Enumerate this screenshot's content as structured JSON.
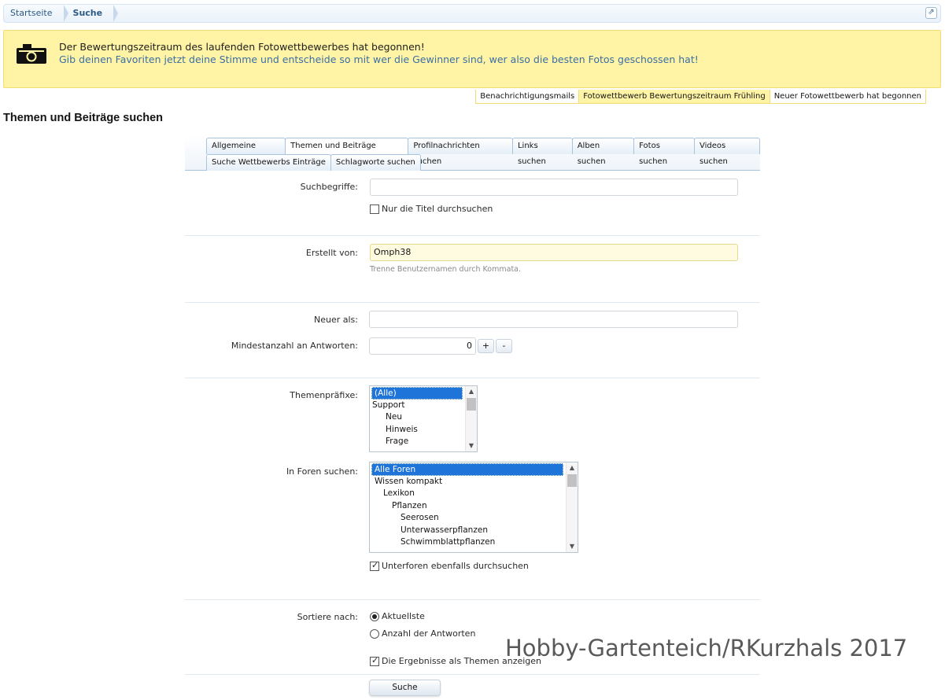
{
  "breadcrumb": {
    "home": "Startseite",
    "current": "Suche"
  },
  "notice": {
    "line1": "Der Bewertungszeitraum des laufenden Fotowettbewerbes hat begonnen!",
    "line2": "Gib deinen Favoriten jetzt deine Stimme und entscheide so mit wer die Gewinner sind, wer also die besten Fotos geschossen hat!",
    "tabs": [
      "Benachrichtigungsmails",
      "Fotowettbewerb Bewertungszeitraum Frühling",
      "Neuer Fotowettbewerb hat begonnen"
    ]
  },
  "page_title": "Themen und Beiträge suchen",
  "tabs_row1": [
    "Allgemeine Suche",
    "Themen und Beiträge suchen",
    "Profilnachrichten suchen",
    "Links suchen",
    "Alben suchen",
    "Fotos suchen",
    "Videos suchen"
  ],
  "tabs_row2": [
    "Suche Wettbewerbs Einträge",
    "Schlagworte suchen"
  ],
  "form": {
    "keywords_label": "Suchbegriffe:",
    "keywords_value": "",
    "titles_only_label": "Nur die Titel durchsuchen",
    "created_by_label": "Erstellt von:",
    "created_by_value": "Omph38",
    "created_by_hint": "Trenne Benutzernamen durch Kommata.",
    "newer_than_label": "Neuer als:",
    "newer_than_value": "",
    "min_replies_label": "Mindestanzahl an Antworten:",
    "min_replies_value": "0",
    "plus": "+",
    "minus": "-",
    "prefixes_label": "Themenpräfixe:",
    "prefixes": [
      "(Alle)",
      "Support",
      "Neu",
      "Hinweis",
      "Frage"
    ],
    "forums_label": "In Foren suchen:",
    "forums": [
      "Alle Foren",
      "Wissen kompakt",
      "Lexikon",
      "Pflanzen",
      "Seerosen",
      "Unterwasserpflanzen",
      "Schwimmblattpflanzen"
    ],
    "subforums_label": "Unterforen ebenfalls durchsuchen",
    "sort_label": "Sortiere nach:",
    "sort_latest": "Aktuellste",
    "sort_replies": "Anzahl der Antworten",
    "as_threads_label": "Die Ergebnisse als Themen anzeigen",
    "submit": "Suche"
  },
  "watermark": "Hobby-Gartenteich/RKurzhals 2017",
  "colors": {
    "notice_bg": "#fff4a5",
    "selection": "#1e74d8",
    "link": "#2b5a85"
  }
}
